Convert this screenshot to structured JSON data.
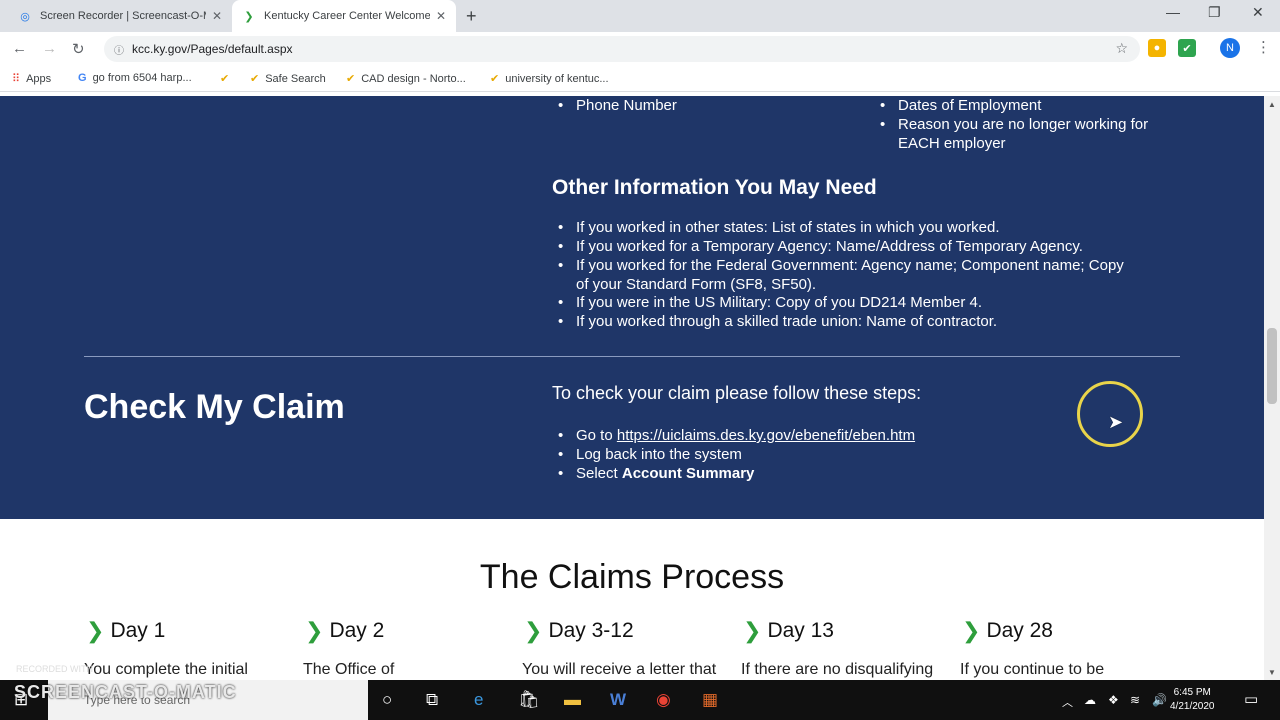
{
  "browser": {
    "tabs": [
      {
        "title": "Screen Recorder | Screencast-O-M"
      },
      {
        "title": "Kentucky Career Center Welcome"
      }
    ],
    "url": "kcc.ky.gov/Pages/default.aspx",
    "avatar_letter": "N",
    "bookmarks": [
      {
        "label": "Apps",
        "icon": "apps-grid-icon"
      },
      {
        "label": "go from 6504 harp...",
        "icon": "google-g-icon"
      },
      {
        "label": "Safe Search",
        "icon": "norton-check-icon"
      },
      {
        "label": "CAD design - Norto...",
        "icon": "norton-check-icon"
      },
      {
        "label": "university of kentuc...",
        "icon": "norton-check-icon"
      }
    ]
  },
  "employer_info": {
    "left_items": [
      "Phone Number"
    ],
    "right_items": [
      "Dates of Employment",
      "Reason you are no longer working for EACH employer"
    ]
  },
  "other_info": {
    "heading": "Other Information You May Need",
    "items": [
      "If you worked in other states: List of states in which you worked.",
      "If you worked for a Temporary Agency: Name/Address of Temporary Agency.",
      "If you worked for the Federal Government: Agency name; Component name; Copy",
      "of your Standard Form (SF8, SF50).",
      "If you were in the US Military: Copy of you DD214 Member 4.",
      "If you worked through a skilled trade union: Name of contractor."
    ]
  },
  "check_claim": {
    "heading": "Check My Claim",
    "steps_title": "To check your claim please follow these steps:",
    "step1_prefix": "Go to ",
    "step1_link": "https://uiclaims.des.ky.gov/ebenefit/eben.htm",
    "step2": "Log back into the system",
    "step3_prefix": "Select ",
    "step3_bold": "Account Summary"
  },
  "claims_process": {
    "heading": "The Claims Process",
    "days": [
      {
        "label": "Day 1",
        "text": "You complete the initial"
      },
      {
        "label": "Day 2",
        "text": "The Office of"
      },
      {
        "label": "Day 3-12",
        "text": "You will receive a letter that"
      },
      {
        "label": "Day 13",
        "text": "If there are no disqualifying"
      },
      {
        "label": "Day 28",
        "text": "If you continue to be"
      }
    ]
  },
  "taskbar": {
    "search_placeholder": "Type here to search",
    "time": "6:45 PM",
    "date": "4/21/2020",
    "watermark": "SCREENCAST-O-MATIC",
    "watermark_small": "RECORDED WITH"
  }
}
